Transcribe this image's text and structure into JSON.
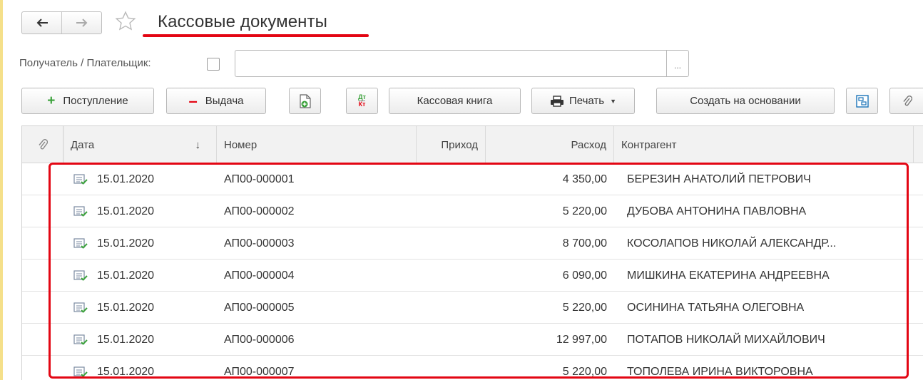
{
  "header": {
    "title": "Кассовые документы",
    "back_icon": "arrow-left-icon",
    "forward_icon": "arrow-right-icon",
    "favorite_icon": "star-icon"
  },
  "filter": {
    "label": "Получатель / Плательщик:",
    "value": "",
    "select_label": "..."
  },
  "toolbar": {
    "receipt_label": "Поступление",
    "issue_label": "Выдача",
    "cash_book_label": "Кассовая книга",
    "print_label": "Печать",
    "create_based_on_label": "Создать на основании",
    "dtkt_dt": "Дт",
    "dtkt_kt": "Кт"
  },
  "table": {
    "columns": {
      "attach": "",
      "date": "Дата",
      "date_sort": "↓",
      "number": "Номер",
      "income": "Приход",
      "expense": "Расход",
      "counterparty": "Контрагент"
    },
    "rows": [
      {
        "date": "15.01.2020",
        "number": "АП00-000001",
        "income": "",
        "expense": "4 350,00",
        "counterparty": "БЕРЕЗИН АНАТОЛИЙ ПЕТРОВИЧ"
      },
      {
        "date": "15.01.2020",
        "number": "АП00-000002",
        "income": "",
        "expense": "5 220,00",
        "counterparty": "ДУБОВА АНТОНИНА ПАВЛОВНА"
      },
      {
        "date": "15.01.2020",
        "number": "АП00-000003",
        "income": "",
        "expense": "8 700,00",
        "counterparty": "КОСОЛАПОВ НИКОЛАЙ АЛЕКСАНДР..."
      },
      {
        "date": "15.01.2020",
        "number": "АП00-000004",
        "income": "",
        "expense": "6 090,00",
        "counterparty": "МИШКИНА ЕКАТЕРИНА АНДРЕЕВНА"
      },
      {
        "date": "15.01.2020",
        "number": "АП00-000005",
        "income": "",
        "expense": "5 220,00",
        "counterparty": "ОСИНИНА ТАТЬЯНА ОЛЕГОВНА"
      },
      {
        "date": "15.01.2020",
        "number": "АП00-000006",
        "income": "",
        "expense": "12 997,00",
        "counterparty": "ПОТАПОВ НИКОЛАЙ МИХАЙЛОВИЧ"
      },
      {
        "date": "15.01.2020",
        "number": "АП00-000007",
        "income": "",
        "expense": "5 220,00",
        "counterparty": "ТОПОЛЕВА ИРИНА ВИКТОРОВНА"
      }
    ]
  },
  "colors": {
    "highlight": "#e30613",
    "accent_green": "#3aa13a"
  }
}
